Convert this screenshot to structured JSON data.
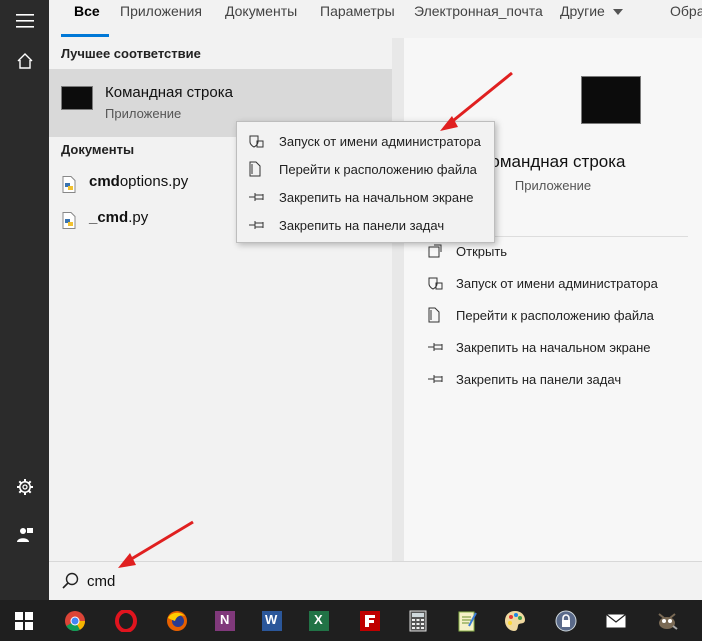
{
  "tabs": [
    {
      "label": "Все"
    },
    {
      "label": "Приложения"
    },
    {
      "label": "Документы"
    },
    {
      "label": "Параметры"
    },
    {
      "label": "Электронная_почта"
    },
    {
      "label": "Другие"
    },
    {
      "label": "Обра"
    }
  ],
  "results": {
    "best_match_heading": "Лучшее соответствие",
    "best_match": {
      "title": "Командная строка",
      "subtitle": "Приложение"
    },
    "documents_heading": "Документы",
    "documents": [
      {
        "bold": "cmd",
        "rest": "options.py"
      },
      {
        "bold": "_cmd",
        "rest": ".py"
      }
    ]
  },
  "context_menu": {
    "items": [
      {
        "label": "Запуск от имени администратора",
        "icon": "shield-icon"
      },
      {
        "label": "Перейти к расположению файла",
        "icon": "file-location-icon"
      },
      {
        "label": "Закрепить на начальном экране",
        "icon": "pin-icon"
      },
      {
        "label": "Закрепить на панели задач",
        "icon": "pin-icon"
      }
    ]
  },
  "preview": {
    "title": "Командная строка",
    "subtitle": "Приложение",
    "actions": [
      {
        "label": "Открыть",
        "icon": "open-icon"
      },
      {
        "label": "Запуск от имени администратора",
        "icon": "shield-icon"
      },
      {
        "label": "Перейти к расположению файла",
        "icon": "file-location-icon"
      },
      {
        "label": "Закрепить на начальном экране",
        "icon": "pin-icon"
      },
      {
        "label": "Закрепить на панели задач",
        "icon": "pin-icon"
      }
    ]
  },
  "search": {
    "value": "cmd"
  },
  "taskbar": {
    "apps": [
      "windows-start-icon",
      "chrome-icon",
      "opera-icon",
      "firefox-icon",
      "onenote-icon",
      "word-icon",
      "excel-icon",
      "filezilla-icon",
      "calculator-icon",
      "notepad-icon",
      "paint-icon",
      "keepass-icon",
      "mail-icon",
      "gimp-icon"
    ],
    "labels": {
      "onenote": "N",
      "word": "W",
      "excel": "X"
    }
  },
  "colors": {
    "accent": "#0078d7",
    "arrow": "#e02020"
  }
}
